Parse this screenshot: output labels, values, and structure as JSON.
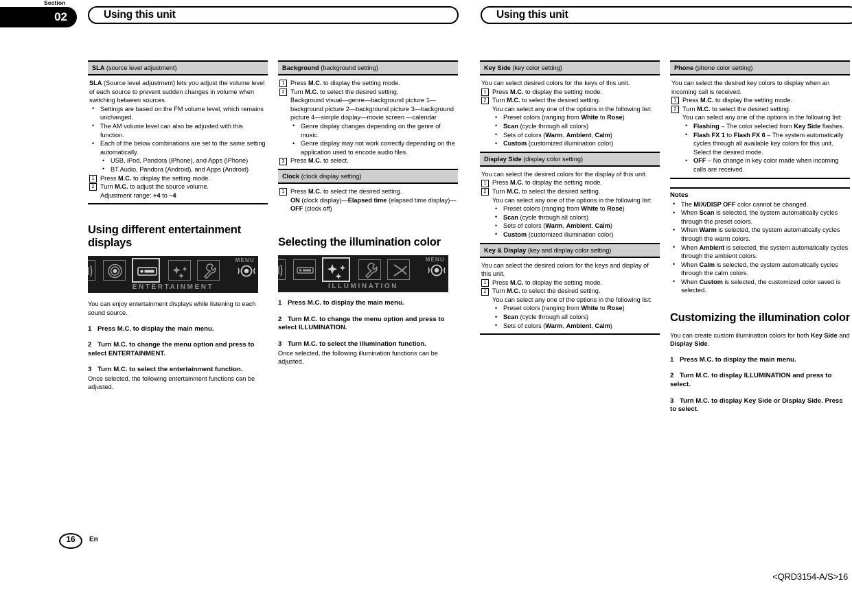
{
  "header": {
    "section_word": "Section",
    "section_number": "02",
    "title_left": "Using this unit",
    "title_right": "Using this unit"
  },
  "footer": {
    "page_number": "16",
    "language": "En",
    "doc_id": "<QRD3154-A/S>16"
  },
  "col1": {
    "sla": {
      "bar_bold": "SLA",
      "bar_rest": " (source level adjustment)",
      "intro_bold": "SLA",
      "intro_rest": " (Source level adjustment) lets you adjust the volume level of each source to prevent sudden changes in volume when switching between sources.",
      "bullets": [
        "Settings are based on the FM volume level, which remains unchanged.",
        "The AM volume level can also be adjusted with this function.",
        "Each of the below combinations are set to the same setting automatically."
      ],
      "subbullets": [
        "USB, iPod, Pandora (iPhone), and Apps (iPhone)",
        "BT Audio, Pandora (Android), and Apps (Android)"
      ],
      "step1_num": "1",
      "step1": "Press M.C. to display the setting mode.",
      "step2_num": "2",
      "step2": "Turn M.C. to adjust the source volume.",
      "step2_sub": "Adjustment range: +4 to –4"
    },
    "entertainment": {
      "heading": "Using different entertainment displays",
      "screen_menu": "MENU",
      "screen_caption": "ENTERTAINMENT",
      "intro": "You can enjoy entertainment displays while listening to each sound source.",
      "steps": [
        {
          "n": "1",
          "text": "Press M.C. to display the main menu."
        },
        {
          "n": "2",
          "text": "Turn M.C. to change the menu option and press to select ENTERTAINMENT."
        },
        {
          "n": "3",
          "text": "Turn M.C. to select the entertainment function."
        }
      ],
      "after": "Once selected, the following entertainment functions can be adjusted."
    }
  },
  "col2": {
    "background": {
      "bar_bold": "Background",
      "bar_rest": " (background setting)",
      "step1_num": "1",
      "step1": "Press M.C. to display the setting mode.",
      "step2_num": "2",
      "step2": "Turn M.C. to select the desired setting.",
      "step2_sub": "Background visual—genre—background picture 1—background picture 2—background picture 3—background picture 4—simple display—movie screen —calendar",
      "bullets": [
        "Genre display changes depending on the genre of music.",
        "Genre display may not work correctly depending on the application used to encode audio files."
      ],
      "step3_num": "3",
      "step3": "Press M.C. to select."
    },
    "clock": {
      "bar_bold": "Clock",
      "bar_rest": " (clock display setting)",
      "step1_num": "1",
      "step1": "Press M.C. to select the desired setting.",
      "step1_sub": "ON (clock display)—Elapsed time (elapsed time display)—OFF (clock off)"
    },
    "illumination": {
      "heading": "Selecting the illumination color",
      "screen_menu": "MENU",
      "screen_caption": "ILLUMINATION",
      "steps": [
        {
          "n": "1",
          "text": "Press M.C. to display the main menu."
        },
        {
          "n": "2",
          "text": "Turn M.C. to change the menu option and press to select ILLUMINATION."
        },
        {
          "n": "3",
          "text": "Turn M.C. to select the illumination function."
        }
      ],
      "after": "Once selected, the following illumination functions can be adjusted."
    }
  },
  "col3": {
    "key_side": {
      "bar_bold": "Key Side",
      "bar_rest": " (key color setting)",
      "intro": "You can select desired colors for the keys of this unit.",
      "step1_num": "1",
      "step1": "Press M.C. to display the setting mode.",
      "step2_num": "2",
      "step2": "Turn M.C. to select the desired setting.",
      "step2_sub": "You can select any one of the options in the following list:",
      "options": [
        "Preset colors (ranging from White to Rose)",
        "Scan (cycle through all colors)",
        "Sets of colors (Warm, Ambient, Calm)",
        "Custom (customized illumination color)"
      ]
    },
    "display_side": {
      "bar_bold": "Display Side",
      "bar_rest": " (display color setting)",
      "intro": "You can select the desired colors for the display of this unit.",
      "step1_num": "1",
      "step1": "Press M.C. to display the setting mode.",
      "step2_num": "2",
      "step2": "Turn M.C. to select the desired setting.",
      "step2_sub": "You can select any one of the options in the following list:",
      "options": [
        "Preset colors (ranging from White to Rose)",
        "Scan (cycle through all colors)",
        "Sets of colors (Warm, Ambient, Calm)",
        "Custom (customized illumination color)"
      ]
    },
    "key_display": {
      "bar_bold": "Key & Display",
      "bar_rest": " (key and display color setting)",
      "intro": "You can select the desired colors for the keys and display of this unit.",
      "step1_num": "1",
      "step1": "Press M.C. to display the setting mode.",
      "step2_num": "2",
      "step2": "Turn M.C. to select the desired setting.",
      "step2_sub": "You can select any one of the options in the following list:",
      "options": [
        "Preset colors (ranging from White to Rose)",
        "Scan (cycle through all colors)",
        "Sets of colors (Warm, Ambient, Calm)"
      ]
    }
  },
  "col4": {
    "phone": {
      "bar_bold": "Phone",
      "bar_rest": " (phone color setting)",
      "intro": "You can select the desired key colors to display when an incoming call is received.",
      "step1_num": "1",
      "step1": "Press M.C. to display the setting mode.",
      "step2_num": "2",
      "step2": "Turn M.C. to select the desired setting.",
      "step2_sub": "You can select any one of the options in the following list:",
      "options": [
        "Flashing – The color selected from Key Side flashes.",
        "Flash FX 1 to Flash FX 6 – The system automatically cycles through all available key colors for this unit. Select the desired mode.",
        "OFF – No change in key color made when incoming calls are received."
      ]
    },
    "notes": {
      "title": "Notes",
      "items": [
        "The MIX/DISP OFF color cannot be changed.",
        "When Scan is selected, the system automatically cycles through the preset colors.",
        "When Warm is selected, the system automatically cycles through the warm colors.",
        "When Ambient is selected, the system automatically cycles through the ambient colors.",
        "When Calm is selected, the system automatically cycles through the calm colors.",
        "When Custom is selected, the customized color saved is selected."
      ]
    },
    "customizing": {
      "heading": "Customizing the illumination color",
      "intro": "You can create custom illumination colors for both Key Side and Display Side.",
      "steps": [
        {
          "n": "1",
          "text": "Press M.C. to display the main menu."
        },
        {
          "n": "2",
          "text": "Turn M.C. to display ILLUMINATION and press to select."
        },
        {
          "n": "3",
          "text": "Turn M.C. to display Key Side or Display Side. Press to select."
        }
      ]
    }
  },
  "colors": {
    "bar_gray": "#cfcfcf",
    "screen_bg": "#1a1a1a",
    "screen_text": "#8f8f8f"
  }
}
